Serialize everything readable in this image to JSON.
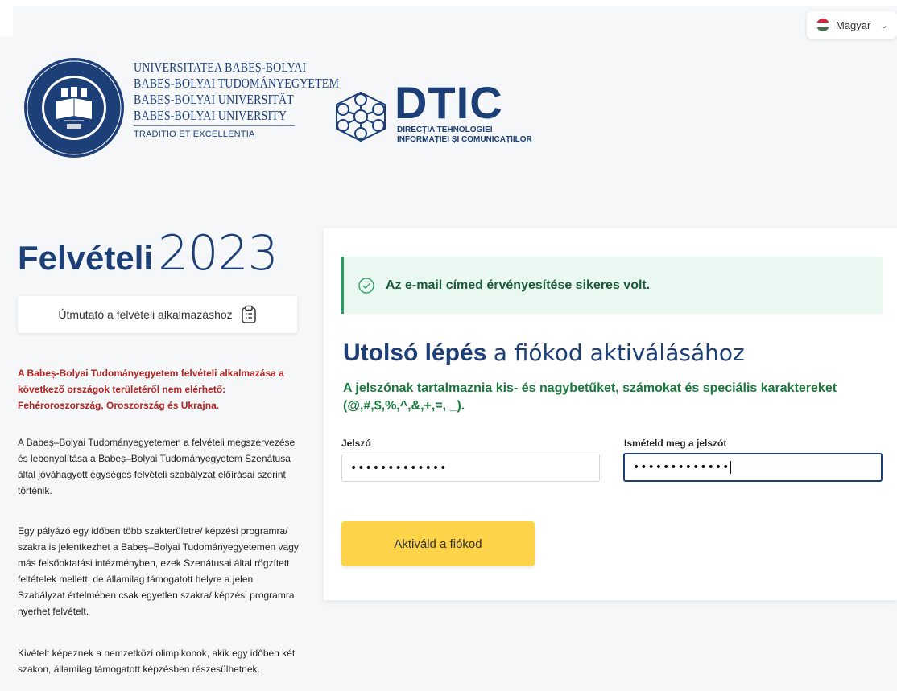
{
  "language": {
    "selected": "Magyar",
    "flag_colors": [
      "#cd2a3e",
      "#ffffff",
      "#436f4d"
    ]
  },
  "ubb": {
    "lines": [
      "UNIVERSITATEA BABEȘ-BOLYAI",
      "BABEȘ-BOLYAI TUDOMÁNYEGYETEM",
      "BABEȘ-BOLYAI UNIVERSITÄT",
      "BABEȘ-BOLYAI UNIVERSITY"
    ],
    "motto": "TRADITIO ET EXCELLENTIA"
  },
  "dtic": {
    "name": "DTIC",
    "subtitle_line1": "DIRECȚIA TEHNOLOGIEI",
    "subtitle_line2": "INFORMAȚIEI ȘI COMUNICAȚIILOR"
  },
  "page": {
    "title_bold": "Felvételi",
    "title_year": "2023",
    "guide_button": "Útmutató a felvételi alkalmazáshoz",
    "warning": "A Babeș-Bolyai Tudományegyetem felvételi alkalmazása a következő országok területéről nem elérhető: Fehéroroszország, Oroszország és Ukrajna.",
    "paragraphs": [
      "A Babeș–Bolyai Tudományegyetemen a felvételi megszervezése és lebonyolítása a Babeș–Bolyai Tudományegyetem Szenátusa által jóváhagyott egységes felvételi szabályzat előírásai szerint történik.",
      "Egy pályázó egy időben több szakterületre/ képzési programra/ szakra is jelentkezhet a Babeș–Bolyai Tudományegyetemen vagy más felsőoktatási intézményben, ezek Szenátusai által rögzített feltételek mellett, de államilag támogatott helyre a jelen Szabályzat értelmében csak egyetlen szakra/ képzési programra nyerhet felvételt.",
      "Kivételt képeznek a nemzetközi olimpikonok, akik egy időben két szakon, államilag támogatott képzésben részesülhetnek."
    ]
  },
  "card": {
    "alert": "Az e-mail címed érvényesítése sikeres volt.",
    "title_bold": "Utolsó lépés",
    "title_rest": "a fiókod aktiválásához",
    "hint": "A jelszónak tartalmaznia kis- és nagybetűket, számokat és speciális karaktereket (@,#,$,%,^,&,+,=, _).",
    "password_label": "Jelszó",
    "password_value": "•••••••••••••",
    "confirm_label": "Ismételd meg a jelszót",
    "confirm_value": "•••••••••••••",
    "submit": "Aktiváld a fiókod"
  },
  "colors": {
    "brand_navy": "#1c3f78",
    "warning_red": "#b52524",
    "success_green": "#1a7a3e",
    "button_yellow": "#fdd34a"
  }
}
